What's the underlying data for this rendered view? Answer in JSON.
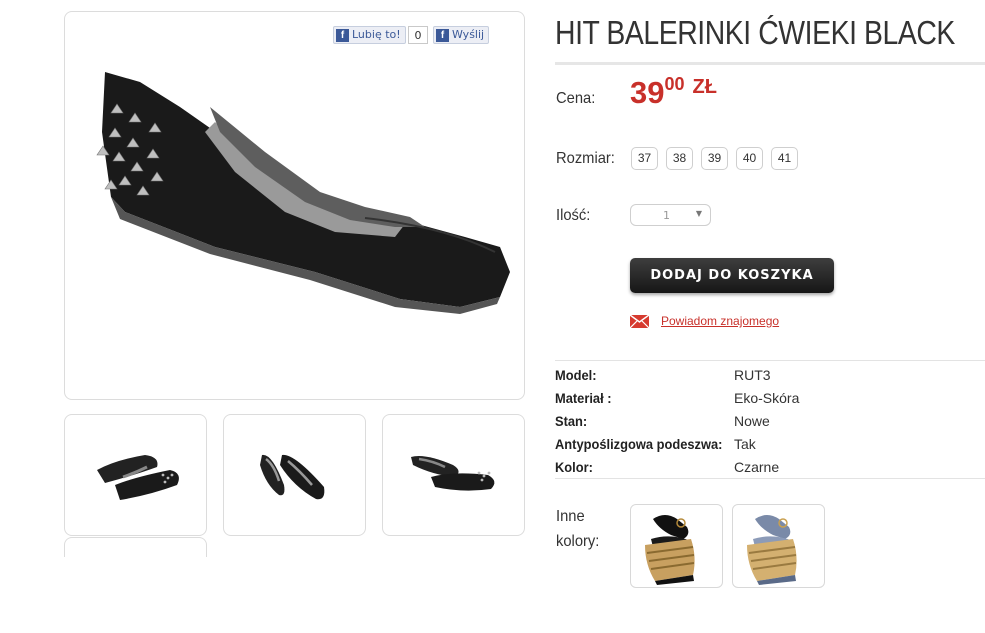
{
  "facebook": {
    "like_label": "Lubię to!",
    "like_count": "0",
    "send_label": "Wyślij",
    "icon_letter": "f"
  },
  "product": {
    "title": "HIT BALERINKI ĆWIEKI BLACK",
    "price_label": "Cena:",
    "price_int": "39",
    "price_dec": "00",
    "currency": "ZŁ",
    "size_label": "Rozmiar:",
    "sizes": [
      "37",
      "38",
      "39",
      "40",
      "41"
    ],
    "qty_label": "Ilość:",
    "qty_value": "1",
    "add_to_cart": "DODAJ DO KOSZYKA",
    "notify_friend": "Powiadom znajomego"
  },
  "specs": [
    {
      "key": "Model:",
      "value": "RUT3"
    },
    {
      "key": "Materiał :",
      "value": "Eko-Skóra"
    },
    {
      "key": "Stan:",
      "value": "Nowe"
    },
    {
      "key": "Antypoślizgowa podeszwa:",
      "value": "Tak"
    },
    {
      "key": "Kolor:",
      "value": "Czarne"
    }
  ],
  "other_colors": {
    "label_line1": "Inne",
    "label_line2": "kolory:"
  },
  "colors": {
    "price_red": "#c8302a",
    "button_dark": "#1e1e1e",
    "facebook_blue": "#3b5998"
  }
}
